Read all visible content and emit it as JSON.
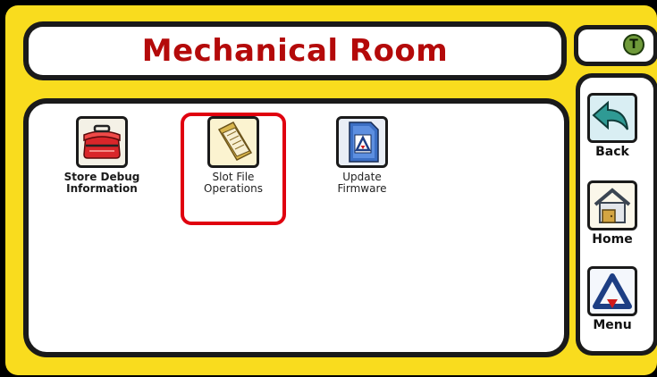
{
  "header": {
    "title": "Mechanical Room"
  },
  "status": {
    "badge_letter": "T",
    "badge_color": "#6f9a3a"
  },
  "tiles": [
    {
      "label": "Store Debug\nInformation",
      "icon": "toolbox-icon",
      "selected": false
    },
    {
      "label": "Slot File\nOperations",
      "icon": "folder-icon",
      "selected": true
    },
    {
      "label": "Update\nFirmware",
      "icon": "sd-card-icon",
      "selected": false
    }
  ],
  "nav": {
    "back_label": "Back",
    "home_label": "Home",
    "menu_label": "Menu"
  },
  "colors": {
    "frame": "#f9dc1e",
    "title_text": "#b40a0a",
    "selection": "#e0000f"
  }
}
